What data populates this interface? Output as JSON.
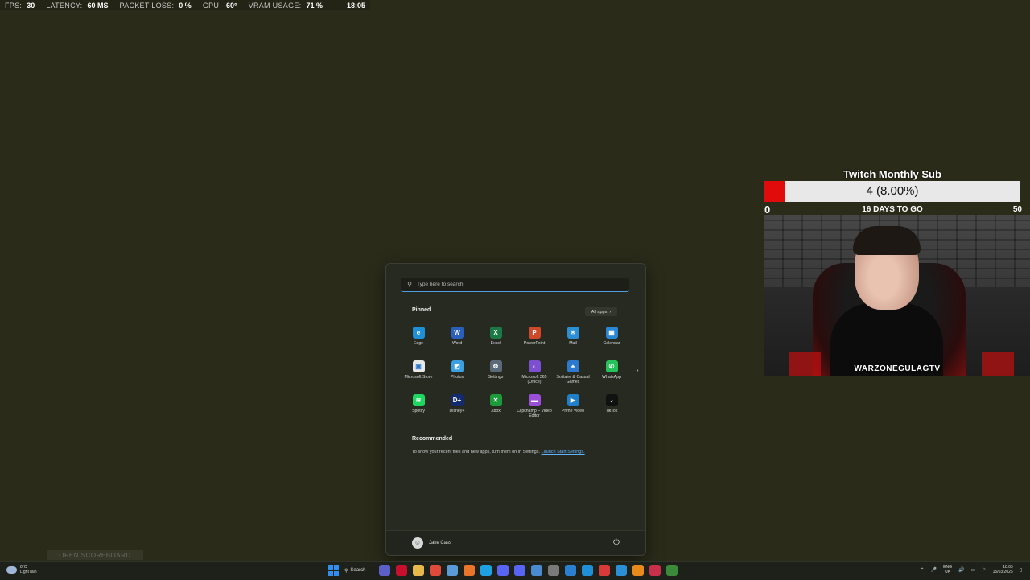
{
  "perf": {
    "fps_label": "FPS:",
    "fps": "30",
    "latency_label": "LATENCY:",
    "latency": "60 MS",
    "loss_label": "PACKET LOSS:",
    "loss": "0 %",
    "gpu_label": "GPU:",
    "gpu": "60°",
    "vram_label": "VRAM USAGE:",
    "vram": "71 %",
    "time": "18:05"
  },
  "twitch_goal": {
    "title": "Twitch Monthly Sub",
    "amount": "4 (8.00%)",
    "progress_fraction": 0.08,
    "min": "0",
    "max": "50",
    "days_left": "16 DAYS TO GO",
    "fill_color": "#e10b0b"
  },
  "webcam": {
    "overlay_logo": "WARZONEGULAGTV"
  },
  "start_menu": {
    "search_placeholder": "Type here to search",
    "pinned_title": "Pinned",
    "all_apps_label": "All apps",
    "pinned": [
      {
        "name": "Edge",
        "icon": "edge-icon",
        "color": "#1f8fd8",
        "glyph": "e"
      },
      {
        "name": "Word",
        "icon": "word-icon",
        "color": "#2b5fbd",
        "glyph": "W"
      },
      {
        "name": "Excel",
        "icon": "excel-icon",
        "color": "#1b7a43",
        "glyph": "X"
      },
      {
        "name": "PowerPoint",
        "icon": "powerpoint-icon",
        "color": "#d0482a",
        "glyph": "P"
      },
      {
        "name": "Mail",
        "icon": "mail-icon",
        "color": "#2b8fd6",
        "glyph": "✉"
      },
      {
        "name": "Calendar",
        "icon": "calendar-icon",
        "color": "#2a87d4",
        "glyph": "▦"
      },
      {
        "name": "Microsoft Store",
        "icon": "store-icon",
        "color": "#e8e8e8",
        "glyph": "▣"
      },
      {
        "name": "Photos",
        "icon": "photos-icon",
        "color": "#3aa0e0",
        "glyph": "◩"
      },
      {
        "name": "Settings",
        "icon": "settings-icon",
        "color": "#5a6a7a",
        "glyph": "⚙"
      },
      {
        "name": "Microsoft 365 (Office)",
        "icon": "office-icon",
        "color": "#7b4fd0",
        "glyph": "◐"
      },
      {
        "name": "Solitaire & Casual Games",
        "icon": "solitaire-icon",
        "color": "#2b7ad0",
        "glyph": "♠"
      },
      {
        "name": "WhatsApp",
        "icon": "whatsapp-icon",
        "color": "#25c25a",
        "glyph": "✆"
      },
      {
        "name": "Spotify",
        "icon": "spotify-icon",
        "color": "#1ed760",
        "glyph": "≋"
      },
      {
        "name": "Disney+",
        "icon": "disney-icon",
        "color": "#142a6e",
        "glyph": "D+"
      },
      {
        "name": "Xbox",
        "icon": "xbox-icon",
        "color": "#1d9a3a",
        "glyph": "✕"
      },
      {
        "name": "Clipchamp – Video Editor",
        "icon": "clipchamp-icon",
        "color": "#9b4fd8",
        "glyph": "▬"
      },
      {
        "name": "Prime Video",
        "icon": "prime-video-icon",
        "color": "#1f7fc8",
        "glyph": "▶"
      },
      {
        "name": "TikTok",
        "icon": "tiktok-icon",
        "color": "#111111",
        "glyph": "♪"
      }
    ],
    "recommended_title": "Recommended",
    "recommended_text": "To show your recent files and new apps, turn them on in Settings.",
    "recommended_link": "Launch Start Settings.",
    "user_name": "Jake Cass"
  },
  "faint_button": "OPEN SCOREBOARD",
  "taskbar": {
    "weather_temp": "8°C",
    "weather_desc": "Light rain",
    "search_label": "Search",
    "lang_top": "ENG",
    "lang_bottom": "UK",
    "clock_time": "18:05",
    "clock_date": "15/03/2025",
    "pinned_icons": [
      {
        "icon": "teams-icon",
        "color": "#5b5fc7"
      },
      {
        "icon": "mcafee-icon",
        "color": "#c8102e"
      },
      {
        "icon": "file-explorer-icon",
        "color": "#e8b84a"
      },
      {
        "icon": "chrome-icon",
        "color": "#e04a3a"
      },
      {
        "icon": "globe-icon",
        "color": "#5a9ad8"
      },
      {
        "icon": "firefox-icon",
        "color": "#e8752a"
      },
      {
        "icon": "skype-icon",
        "color": "#1da1e0"
      },
      {
        "icon": "discord-icon",
        "color": "#5865f2"
      },
      {
        "icon": "discord-icon",
        "color": "#5865f2"
      },
      {
        "icon": "onedrive-icon",
        "color": "#4a8ad0"
      },
      {
        "icon": "gear-icon",
        "color": "#7a7a7a"
      },
      {
        "icon": "vscode-icon",
        "color": "#2a7fd0"
      },
      {
        "icon": "edge-icon",
        "color": "#1f8fd8"
      },
      {
        "icon": "news-icon",
        "color": "#d83a3a"
      },
      {
        "icon": "edge-icon",
        "color": "#2b8fd6"
      },
      {
        "icon": "obs-icon",
        "color": "#e88a1a"
      },
      {
        "icon": "app-icon",
        "color": "#c8304a"
      },
      {
        "icon": "terminal-icon",
        "color": "#3a8a3a"
      }
    ]
  }
}
